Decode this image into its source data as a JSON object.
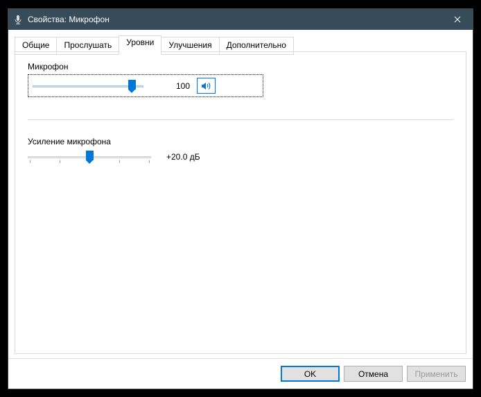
{
  "window": {
    "title": "Свойства: Микрофон",
    "close_label": "Close"
  },
  "tabs": [
    {
      "id": "general",
      "label": "Общие",
      "selected": false
    },
    {
      "id": "listen",
      "label": "Прослушать",
      "selected": false
    },
    {
      "id": "levels",
      "label": "Уровни",
      "selected": true
    },
    {
      "id": "enhancements",
      "label": "Улучшения",
      "selected": false
    },
    {
      "id": "advanced",
      "label": "Дополнительно",
      "selected": false
    }
  ],
  "groups": {
    "mic": {
      "label": "Микрофон",
      "value": 100,
      "percent": 92,
      "value_text": "100",
      "mute_icon": "speaker-on"
    },
    "boost": {
      "label": "Усиление микрофона",
      "percent": 50,
      "value_text": "+20.0 дБ",
      "ticks_percent": [
        0,
        25,
        50,
        75,
        100
      ]
    }
  },
  "buttons": {
    "ok": "OK",
    "cancel": "Отмена",
    "apply": "Применить"
  }
}
